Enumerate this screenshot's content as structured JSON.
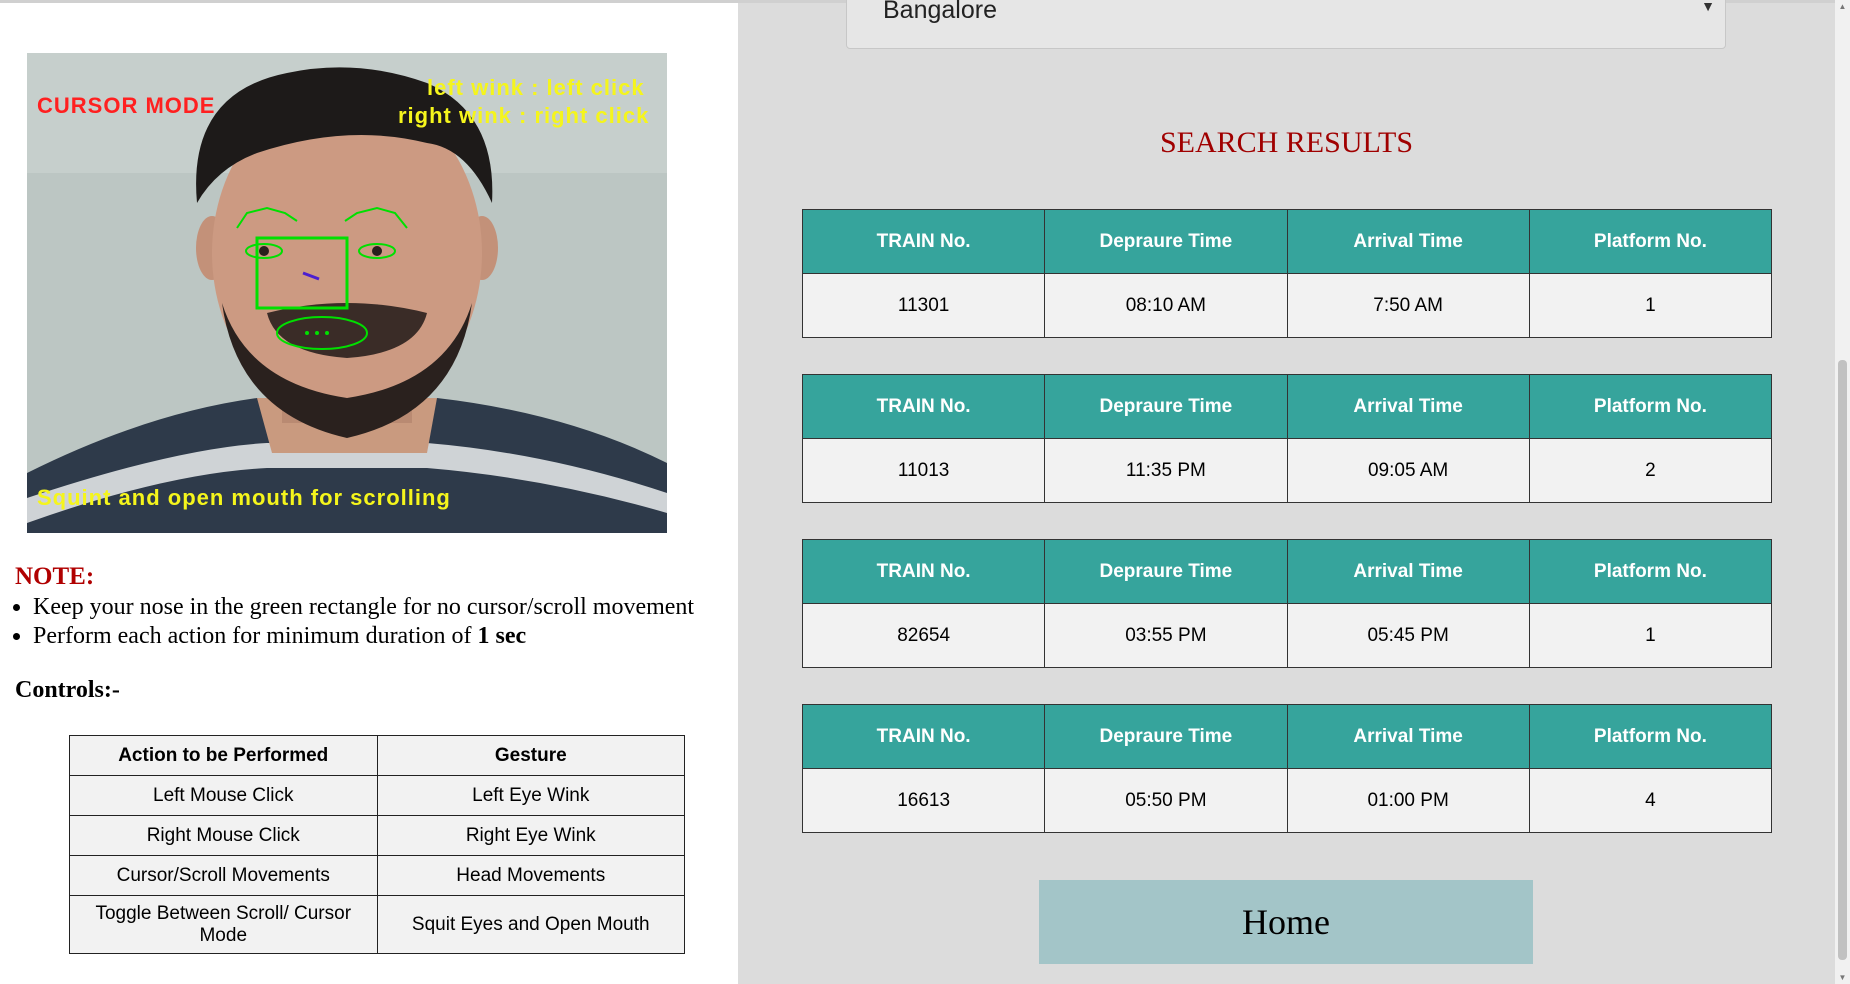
{
  "camera": {
    "mode_label": "CURSOR MODE",
    "left_wink_hint": "left wink : left click",
    "right_wink_hint": "right wink : right click",
    "scroll_hint": "Squint and open mouth for scrolling"
  },
  "note": {
    "title": "NOTE:",
    "item1": "Keep your nose in the green rectangle for no cursor/scroll movement",
    "item2_prefix": "Perform each action for minimum duration of ",
    "item2_bold": "1 sec"
  },
  "controls": {
    "title": "Controls:-",
    "headers": [
      "Action to be Performed",
      "Gesture"
    ],
    "rows": [
      [
        "Left Mouse Click",
        "Left Eye Wink"
      ],
      [
        "Right Mouse Click",
        "Right Eye Wink"
      ],
      [
        "Cursor/Scroll Movements",
        "Head Movements"
      ],
      [
        "Toggle Between Scroll/ Cursor Mode",
        "Squit Eyes and Open Mouth"
      ]
    ]
  },
  "search": {
    "city_value": "Bangalore",
    "results_title": "SEARCH RESULTS",
    "headers": [
      "TRAIN No.",
      "Depraure Time",
      "Arrival Time",
      "Platform No."
    ],
    "results": [
      [
        "11301",
        "08:10 AM",
        "7:50 AM",
        "1"
      ],
      [
        "11013",
        "11:35 PM",
        "09:05 AM",
        "2"
      ],
      [
        "82654",
        "03:55 PM",
        "05:45 PM",
        "1"
      ],
      [
        "16613",
        "05:50 PM",
        "01:00 PM",
        "4"
      ]
    ],
    "home_label": "Home"
  },
  "colors": {
    "header_teal": "#36a49c",
    "results_title_red": "#a00000",
    "home_button": "#a3c5c8",
    "note_red": "#b00000",
    "overlay_yellow": "#f5f51c",
    "overlay_red": "#ff2020",
    "landmark_green": "#00e000"
  }
}
